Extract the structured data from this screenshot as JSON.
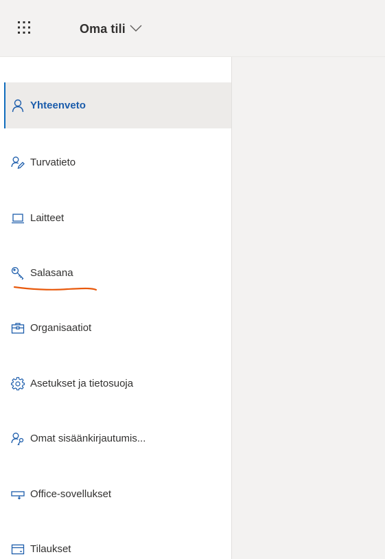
{
  "header": {
    "app_launcher_icon": "waffle-icon",
    "account_title": "Oma tili",
    "chevron_icon": "chevron-down-icon"
  },
  "sidebar": {
    "active_color": "#1b5cab",
    "items": [
      {
        "label": "Yhteenveto",
        "icon": "person-icon",
        "active": true
      },
      {
        "label": "Turvatieto",
        "icon": "person-pen-icon",
        "active": false
      },
      {
        "label": "Laitteet",
        "icon": "laptop-icon",
        "active": false
      },
      {
        "label": "Salasana",
        "icon": "key-icon",
        "active": false
      },
      {
        "label": "Organisaatiot",
        "icon": "briefcase-icon",
        "active": false
      },
      {
        "label": "Asetukset ja tietosuoja",
        "icon": "gear-icon",
        "active": false
      },
      {
        "label": "Omat sisäänkirjautumis...",
        "icon": "person-key-icon",
        "active": false
      },
      {
        "label": "Office-sovellukset",
        "icon": "office-apps-icon",
        "active": false
      },
      {
        "label": "Tilaukset",
        "icon": "subscription-card-icon",
        "active": false
      }
    ]
  },
  "annotation": {
    "color": "#e8590c"
  }
}
